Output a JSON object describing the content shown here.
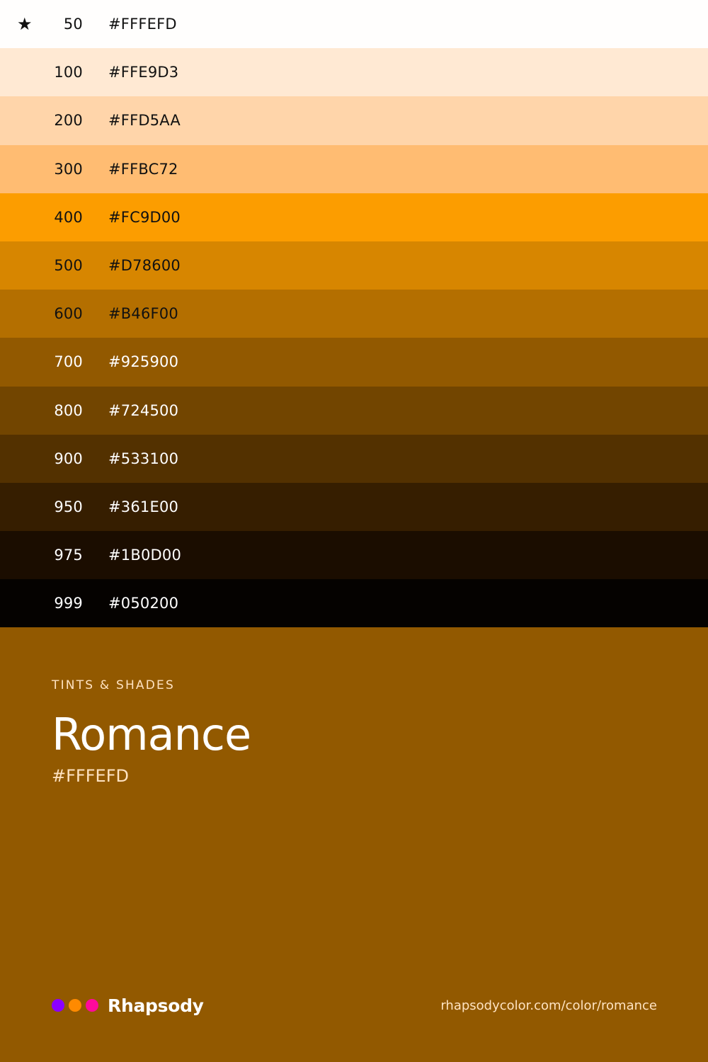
{
  "swatches": [
    {
      "step": "50",
      "hex": "#FFFEFD",
      "bg": "#FFFEFD",
      "text_color": "#111111",
      "starred": true
    },
    {
      "step": "100",
      "hex": "#FFE9D3",
      "bg": "#FFE9D3",
      "text_color": "#111111",
      "starred": false
    },
    {
      "step": "200",
      "hex": "#FFD5AA",
      "bg": "#FFD5AA",
      "text_color": "#111111",
      "starred": false
    },
    {
      "step": "300",
      "hex": "#FFBC72",
      "bg": "#FFBC72",
      "text_color": "#111111",
      "starred": false
    },
    {
      "step": "400",
      "hex": "#FC9D00",
      "bg": "#FC9D00",
      "text_color": "#111111",
      "starred": false
    },
    {
      "step": "500",
      "hex": "#D78600",
      "bg": "#D78600",
      "text_color": "#111111",
      "starred": false
    },
    {
      "step": "600",
      "hex": "#B46F00",
      "bg": "#B46F00",
      "text_color": "#111111",
      "starred": false
    },
    {
      "step": "700",
      "hex": "#925900",
      "bg": "#925900",
      "text_color": "#FFFFFF",
      "starred": false
    },
    {
      "step": "800",
      "hex": "#724500",
      "bg": "#724500",
      "text_color": "#FFFFFF",
      "starred": false
    },
    {
      "step": "900",
      "hex": "#533100",
      "bg": "#533100",
      "text_color": "#FFFFFF",
      "starred": false
    },
    {
      "step": "950",
      "hex": "#361E00",
      "bg": "#361E00",
      "text_color": "#FFFFFF",
      "starred": false
    },
    {
      "step": "975",
      "hex": "#1B0D00",
      "bg": "#1B0D00",
      "text_color": "#FFFFFF",
      "starred": false
    },
    {
      "step": "999",
      "hex": "#050200",
      "bg": "#050200",
      "text_color": "#FFFFFF",
      "starred": false
    }
  ],
  "star_icon": "star-icon",
  "star_glyph": "★",
  "info": {
    "eyebrow": "TINTS & SHADES",
    "title": "Romance",
    "hex": "#FFFEFD"
  },
  "footer": {
    "brand_name": "Rhapsody",
    "brand_dots": [
      "#8B00FF",
      "#FF8A00",
      "#FF0A9C"
    ],
    "url": "rhapsodycolor.com/color/romance"
  },
  "colors": {
    "panel_background": "#925900"
  }
}
